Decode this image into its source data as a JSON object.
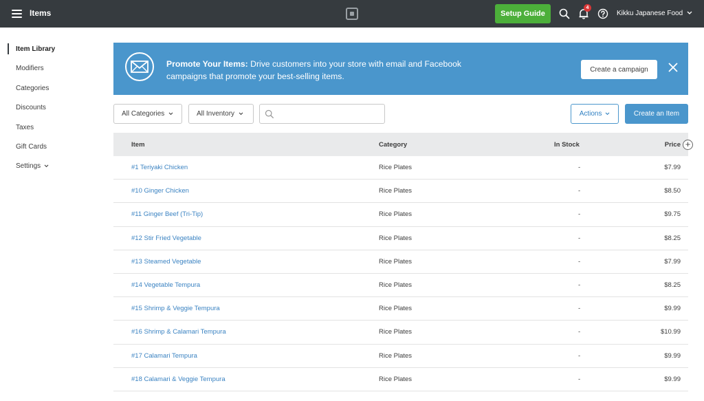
{
  "header": {
    "title": "Items",
    "setup_label": "Setup Guide",
    "notification_count": "4",
    "account_name": "Kikku Japanese Food"
  },
  "sidebar": {
    "items": [
      {
        "label": "Item Library"
      },
      {
        "label": "Modifiers"
      },
      {
        "label": "Categories"
      },
      {
        "label": "Discounts"
      },
      {
        "label": "Taxes"
      },
      {
        "label": "Gift Cards"
      },
      {
        "label": "Settings"
      }
    ]
  },
  "banner": {
    "title": "Promote Your Items:",
    "text": "Drive customers into your store with email and Facebook campaigns that promote your best-selling items.",
    "button_label": "Create a campaign"
  },
  "toolbar": {
    "categories_label": "All Categories",
    "inventory_label": "All Inventory",
    "search_placeholder": "",
    "actions_label": "Actions",
    "create_label": "Create an Item"
  },
  "table": {
    "headers": [
      "Item",
      "Category",
      "In Stock",
      "Price"
    ],
    "rows": [
      {
        "name": "#1 Teriyaki Chicken",
        "category": "Rice Plates",
        "stock": "-",
        "price": "$7.99"
      },
      {
        "name": "#10 Ginger Chicken",
        "category": "Rice Plates",
        "stock": "-",
        "price": "$8.50"
      },
      {
        "name": "#11 Ginger Beef (Tri-Tip)",
        "category": "Rice Plates",
        "stock": "-",
        "price": "$9.75"
      },
      {
        "name": "#12 Stir Fried Vegetable",
        "category": "Rice Plates",
        "stock": "-",
        "price": "$8.25"
      },
      {
        "name": "#13 Steamed Vegetable",
        "category": "Rice Plates",
        "stock": "-",
        "price": "$7.99"
      },
      {
        "name": "#14 Vegetable Tempura",
        "category": "Rice Plates",
        "stock": "-",
        "price": "$8.25"
      },
      {
        "name": "#15 Shrimp & Veggie Tempura",
        "category": "Rice Plates",
        "stock": "-",
        "price": "$9.99"
      },
      {
        "name": "#16 Shrimp & Calamari Tempura",
        "category": "Rice Plates",
        "stock": "-",
        "price": "$10.99"
      },
      {
        "name": "#17 Calamari Tempura",
        "category": "Rice Plates",
        "stock": "-",
        "price": "$9.99"
      },
      {
        "name": "#18 Calamari & Veggie Tempura",
        "category": "Rice Plates",
        "stock": "-",
        "price": "$9.99"
      }
    ]
  },
  "colors": {
    "topbar": "#363b3f",
    "setup_button": "#4caf3a",
    "banner": "#4a96cc",
    "link": "#3b83c2",
    "badge": "#d93737"
  },
  "icons": [
    "menu-icon",
    "square-logo-icon",
    "search-icon",
    "bell-icon",
    "help-icon",
    "chevron-down-icon",
    "envelope-icon",
    "close-icon",
    "plus-icon"
  ]
}
